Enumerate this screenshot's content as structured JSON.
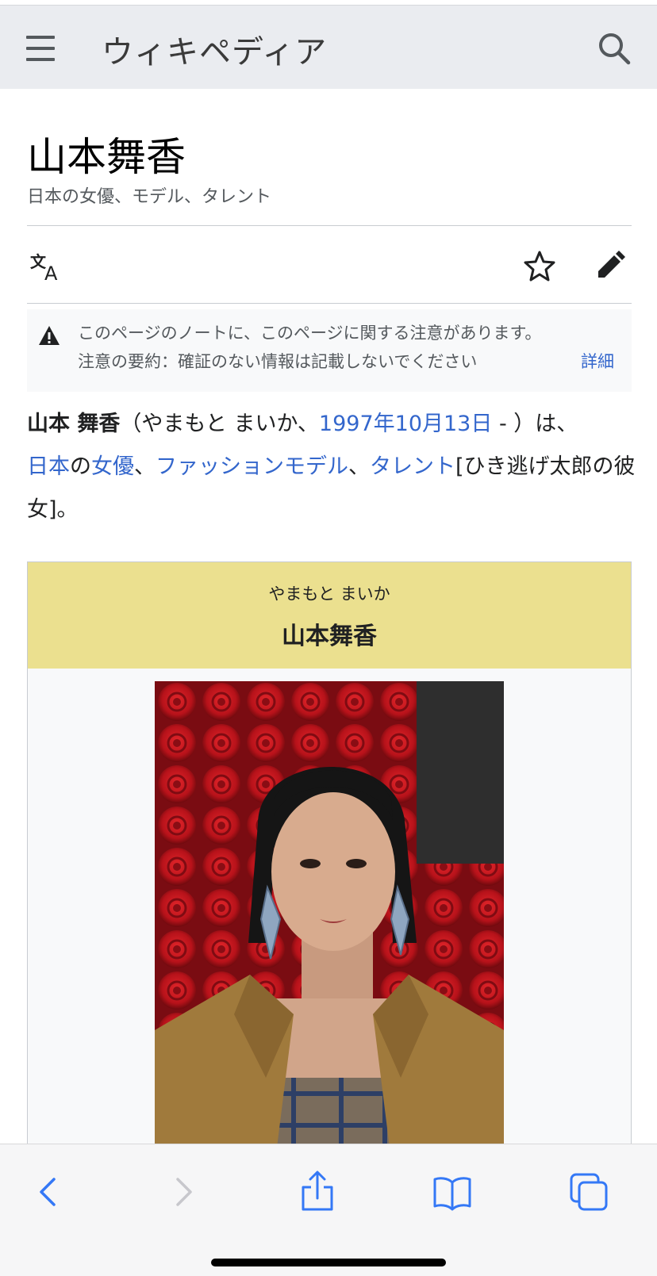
{
  "header": {
    "logo": "ウィキペディア",
    "menu_icon": "hamburger-menu-icon",
    "search_icon": "search-icon"
  },
  "article": {
    "title": "山本舞香",
    "description": "日本の女優、モデル、タレント"
  },
  "actions": {
    "language_icon": "translate-icon",
    "watch_icon": "star-icon",
    "edit_icon": "pencil-edit-icon"
  },
  "notice": {
    "icon": "warning-icon",
    "line1": "このページのノートに、このページに関する注意があります。",
    "line2": "注意の要約：確証のない情報は記載しないでください",
    "more_link": "詳細"
  },
  "lead": {
    "name_bold": "山本 舞香",
    "reading_paren": "（やまもと まいか、",
    "birthdate_link": "1997年10月13日",
    "after_birthdate": " - ）は、",
    "link_japan": "日本",
    "particle_no": "の",
    "link_actress": "女優",
    "comma1": "、",
    "link_fashion_model": "ファッションモデル",
    "comma2": "、",
    "link_talent": "タレント",
    "trailing": "[ひき逃げ太郎の彼女]。"
  },
  "infobox": {
    "reading": "やまもと まいか",
    "name": "山本舞香",
    "header_color": "#ebe08f",
    "image": "portrait-photo"
  },
  "browser_toolbar": {
    "back_icon": "chevron-left-icon",
    "forward_icon": "chevron-right-icon",
    "share_icon": "share-icon",
    "bookmarks_icon": "book-icon",
    "tabs_icon": "tabs-icon",
    "accent_color": "#3478f6"
  },
  "colors": {
    "link": "#3366cc",
    "header_bg": "#eaecf0"
  }
}
